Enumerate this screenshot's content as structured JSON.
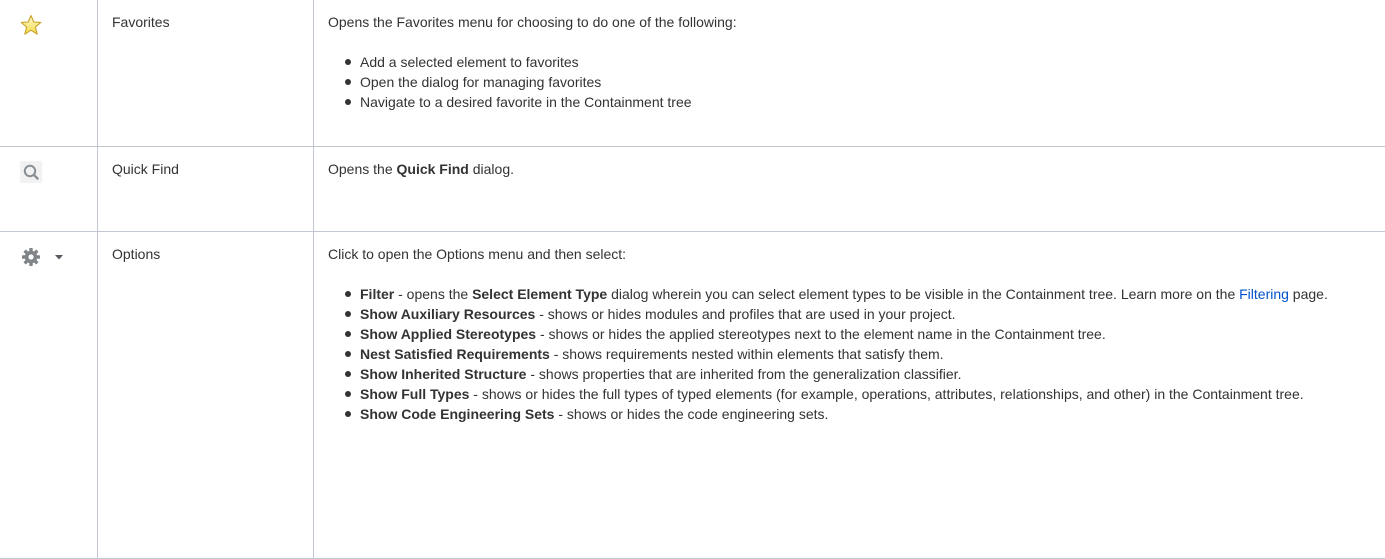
{
  "rows": [
    {
      "icon": "star-icon",
      "name": "Favorites",
      "intro": "Opens the Favorites menu for choosing to do one of the following:",
      "items": [
        "Add a selected element to favorites",
        "Open the dialog for managing favorites",
        "Navigate to a desired favorite in the Containment tree"
      ]
    },
    {
      "icon": "magnifier-icon",
      "name": "Quick Find",
      "desc_prefix": "Opens the ",
      "desc_bold": "Quick Find",
      "desc_suffix": " dialog."
    },
    {
      "icon": "gear-icon",
      "icon2": "chevron-down-icon",
      "name": "Options",
      "intro": "Click to open the Options menu and then select:",
      "items": [
        {
          "bold": "Filter",
          "text1": " - opens the ",
          "bold2": "Select Element Type",
          "text2": " dialog wherein you can select element types to be visible in the Containment tree. Learn more on the ",
          "link": "Filtering",
          "text3": " page."
        },
        {
          "bold": "Show Auxiliary Resources",
          "text": " - shows or hides modules and profiles that are used in your project."
        },
        {
          "bold": "Show Applied Stereotypes",
          "text": " - shows or hides the applied stereotypes next to the element name in the Containment tree."
        },
        {
          "bold": "Nest Satisfied Requirements",
          "text": " - shows requirements nested within elements that satisfy them."
        },
        {
          "bold": "Show Inherited Structure",
          "text": " - shows properties that are inherited from the generalization classifier."
        },
        {
          "bold": "Show Full Types",
          "text": " - shows or hides the full types of typed elements (for example, operations, attributes, relationships, and other) in the Containment tree."
        },
        {
          "bold": "Show Code Engineering Sets",
          "text": " - shows or hides the code engineering sets."
        }
      ]
    }
  ],
  "colors": {
    "text": "#333333",
    "link": "#0052cc",
    "border": "#c1c7d0",
    "star_fill": "#f7e35a",
    "star_stroke": "#c9a227",
    "icon_gray": "#8a8f94"
  }
}
